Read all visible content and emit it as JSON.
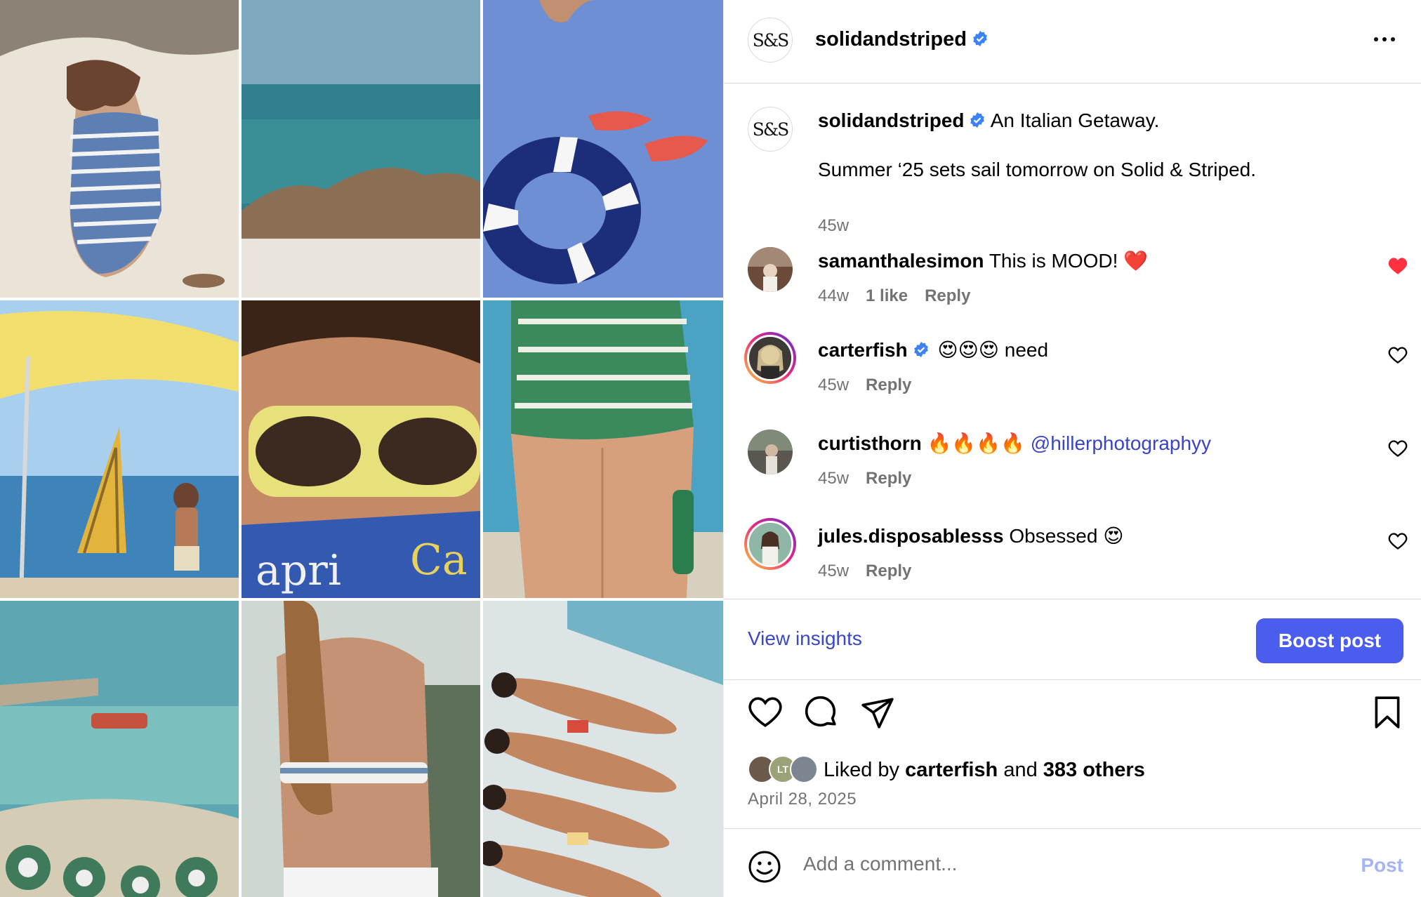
{
  "post": {
    "username": "solidandstriped",
    "avatar_text": "S&S",
    "verified": true,
    "menu_icon": "more-horizontal-icon"
  },
  "caption": {
    "username": "solidandstriped",
    "title": "An Italian Getaway.",
    "body": "Summer ‘25 sets sail tomorrow on Solid & Striped.",
    "time": "45w"
  },
  "comments": [
    {
      "username": "samanthalesimon",
      "text": "This is MOOD!",
      "emoji": "❤️",
      "time": "44w",
      "likes": "1 like",
      "reply": "Reply",
      "liked": true
    },
    {
      "username": "carterfish",
      "verified": true,
      "emoji": "😍😍😍",
      "text": "need",
      "time": "45w",
      "reply": "Reply",
      "liked": false
    },
    {
      "username": "curtisthorn",
      "emoji": "🔥🔥🔥🔥",
      "mention": "@hillerphotographyy",
      "time": "45w",
      "reply": "Reply",
      "liked": false
    },
    {
      "username": "jules.disposablesss",
      "text": "Obsessed",
      "emoji": "😍",
      "time": "45w",
      "reply": "Reply",
      "liked": false
    }
  ],
  "actions": {
    "insights": "View insights",
    "boost": "Boost post"
  },
  "likes": {
    "prefix": "Liked by",
    "user": "carterfish",
    "and": "and",
    "others": "383 others",
    "stack_initials": "LT"
  },
  "date": "April 28, 2025",
  "comment_box": {
    "placeholder": "Add a comment...",
    "post_label": "Post"
  },
  "colors": {
    "accent": "#4a5ded",
    "link": "#3848c6",
    "liked": "#ff3040",
    "verified": "#3b82f6"
  }
}
